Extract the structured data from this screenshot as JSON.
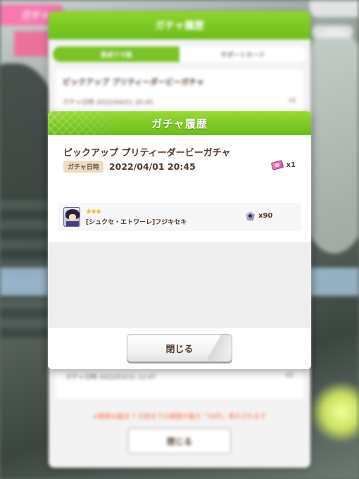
{
  "background": {
    "title": "ガチャ",
    "tabs": {
      "active": "育成ウマ娘",
      "inactive": "サポートカード"
    },
    "entries": [
      {
        "banner": "ピックアップ プリティーダービーガチャ",
        "date_label": "ガチャ日時",
        "date": "2022/04/01 20:45",
        "qty": "x1"
      },
      {
        "date_label": "ガチャ日時",
        "date": "2022/03/31 12:47",
        "qty": "x1"
      }
    ],
    "notice": "※履歴は最近 7 日前までの履歴が最大「30件」表示されます",
    "close_label": "閉じる"
  },
  "back_dialog": {
    "title": "ガチャ履歴"
  },
  "modal": {
    "title": "ガチャ履歴",
    "banner_name": "ピックアップ プリティーダービーガチャ",
    "date_label": "ガチャ日時",
    "date_value": "2022/04/01 20:45",
    "ticket_qty": "x1",
    "results": [
      {
        "stars": "★★★",
        "rarity": 3,
        "character": "[シュクセ・エトワーレ]フジキセキ",
        "piece_qty": "x90"
      }
    ],
    "close_label": "閉じる"
  },
  "icons": {
    "ticket": "gacha-ticket-icon",
    "piece": "uma-piece-icon",
    "portrait": "character-portrait"
  },
  "colors": {
    "header_green": "#7dc826",
    "text_brown": "#4f3b2d",
    "date_label_bg": "#ecdcc4",
    "star_gold": "#f6c21c"
  }
}
